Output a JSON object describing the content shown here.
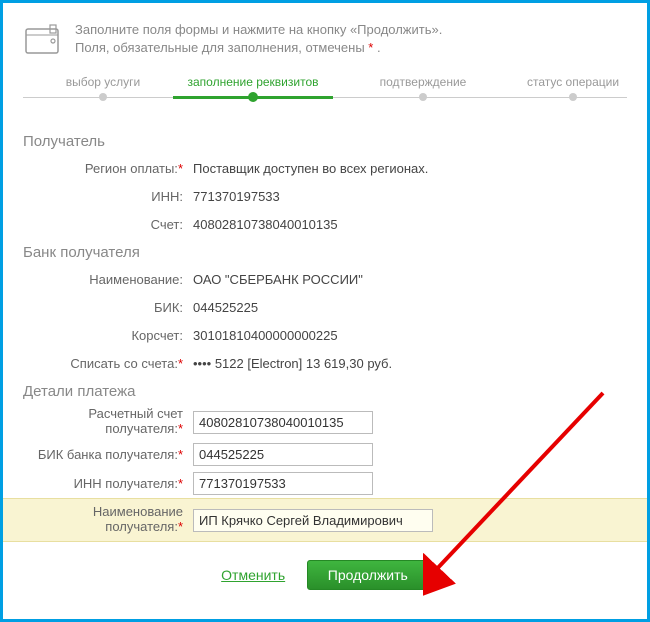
{
  "header": {
    "line1": "Заполните поля формы и нажмите на кнопку «Продолжить».",
    "line2_prefix": "Поля, обязательные для заполнения, отмечены ",
    "line2_suffix": " ."
  },
  "steps": {
    "s1": "выбор услуги",
    "s2": "заполнение реквизитов",
    "s3": "подтверждение",
    "s4": "статус операции"
  },
  "sections": {
    "recipient": "Получатель",
    "bank": "Банк получателя",
    "details": "Детали платежа"
  },
  "labels": {
    "region": "Регион оплаты:",
    "inn": "ИНН:",
    "account": "Счет:",
    "bankName": "Наименование:",
    "bik": "БИК:",
    "korAccount": "Корсчет:",
    "fromAccount": "Списать со счета:",
    "recAccount": "Расчетный счет получателя:",
    "recBik": "БИК банка получателя:",
    "recInn": "ИНН получателя:",
    "recName": "Наименование получателя:"
  },
  "values": {
    "region": "Поставщик доступен во всех регионах.",
    "inn": "771370197533",
    "account": "40802810738040010135",
    "bankName": "ОАО \"СБЕРБАНК РОССИИ\"",
    "bik": "044525225",
    "korAccount": "30101810400000000225",
    "fromAccount": "•••• 5122  [Electron] 13 619,30   руб.",
    "recAccount": "40802810738040010135",
    "recBik": "044525225",
    "recInn": "771370197533",
    "recName": "ИП Крячко Сергей Владимирович"
  },
  "actions": {
    "cancel": "Отменить",
    "continue": "Продолжить"
  }
}
